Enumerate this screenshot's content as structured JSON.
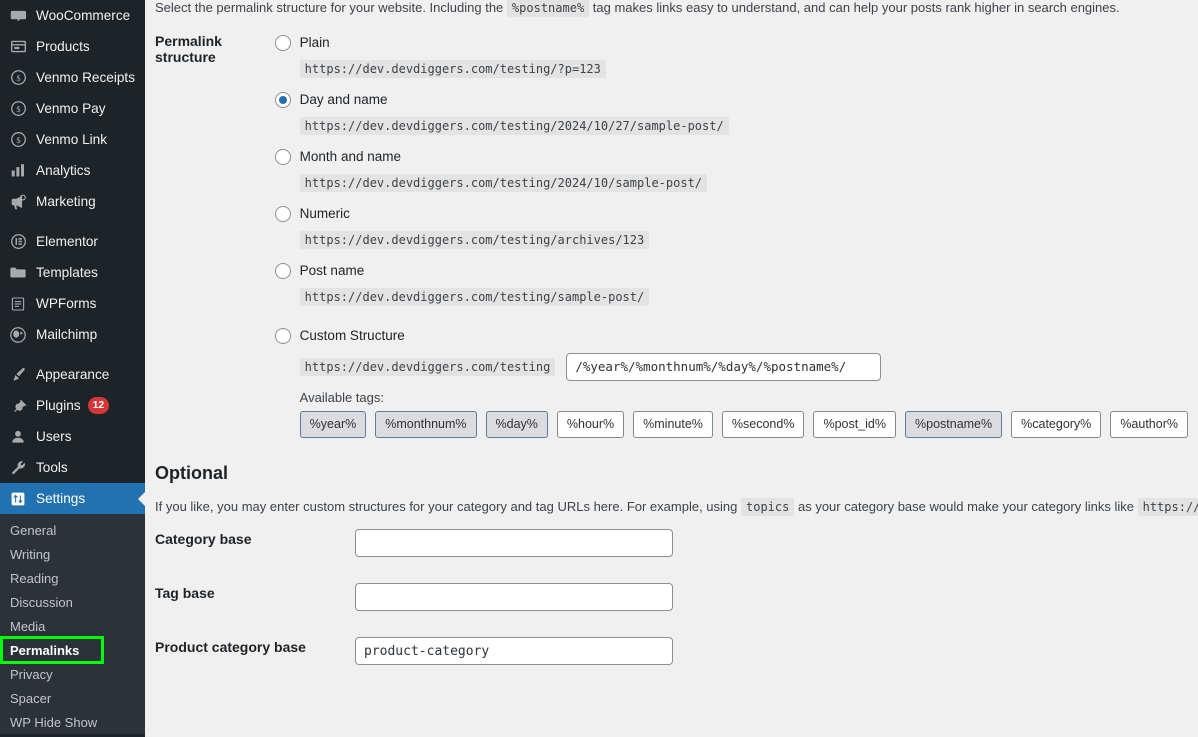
{
  "sidebar": {
    "items": [
      {
        "label": "WooCommerce",
        "icon": "woocommerce-icon"
      },
      {
        "label": "Products",
        "icon": "products-icon"
      },
      {
        "label": "Venmo Receipts",
        "icon": "dollar-icon"
      },
      {
        "label": "Venmo Pay",
        "icon": "dollar-icon"
      },
      {
        "label": "Venmo Link",
        "icon": "dollar-icon"
      },
      {
        "label": "Analytics",
        "icon": "chart-bar-icon"
      },
      {
        "label": "Marketing",
        "icon": "megaphone-icon"
      },
      {
        "label": "Elementor",
        "icon": "elementor-icon"
      },
      {
        "label": "Templates",
        "icon": "folder-icon"
      },
      {
        "label": "WPForms",
        "icon": "form-icon"
      },
      {
        "label": "Mailchimp",
        "icon": "mailchimp-icon"
      },
      {
        "label": "Appearance",
        "icon": "paintbrush-icon"
      },
      {
        "label": "Plugins",
        "icon": "plug-icon",
        "badge": "12"
      },
      {
        "label": "Users",
        "icon": "user-icon"
      },
      {
        "label": "Tools",
        "icon": "wrench-icon"
      },
      {
        "label": "Settings",
        "icon": "settings-icon",
        "active": true
      }
    ],
    "submenu": [
      {
        "label": "General"
      },
      {
        "label": "Writing"
      },
      {
        "label": "Reading"
      },
      {
        "label": "Discussion"
      },
      {
        "label": "Media"
      },
      {
        "label": "Permalinks",
        "current": true,
        "highlighted": true
      },
      {
        "label": "Privacy"
      },
      {
        "label": "Spacer"
      },
      {
        "label": "WP Hide Show"
      }
    ],
    "highlight_color": "#00ff00"
  },
  "intro": {
    "before": "Select the permalink structure for your website. Including the",
    "code": "%postname%",
    "after": "tag makes links easy to understand, and can help your posts rank higher in search engines."
  },
  "permalink": {
    "label": "Permalink structure",
    "options": [
      {
        "label": "Plain",
        "url": "https://dev.devdiggers.com/testing/?p=123",
        "selected": false
      },
      {
        "label": "Day and name",
        "url": "https://dev.devdiggers.com/testing/2024/10/27/sample-post/",
        "selected": true
      },
      {
        "label": "Month and name",
        "url": "https://dev.devdiggers.com/testing/2024/10/sample-post/",
        "selected": false
      },
      {
        "label": "Numeric",
        "url": "https://dev.devdiggers.com/testing/archives/123",
        "selected": false
      },
      {
        "label": "Post name",
        "url": "https://dev.devdiggers.com/testing/sample-post/",
        "selected": false
      }
    ],
    "custom": {
      "label": "Custom Structure",
      "selected": false,
      "prefix": "https://dev.devdiggers.com/testing",
      "value": "/%year%/%monthnum%/%day%/%postname%/"
    },
    "available_tags_label": "Available tags:",
    "tags": [
      {
        "label": "%year%",
        "active": true
      },
      {
        "label": "%monthnum%",
        "active": true
      },
      {
        "label": "%day%",
        "active": true
      },
      {
        "label": "%hour%",
        "active": false
      },
      {
        "label": "%minute%",
        "active": false
      },
      {
        "label": "%second%",
        "active": false
      },
      {
        "label": "%post_id%",
        "active": false
      },
      {
        "label": "%postname%",
        "active": true
      },
      {
        "label": "%category%",
        "active": false
      },
      {
        "label": "%author%",
        "active": false
      }
    ]
  },
  "optional": {
    "title": "Optional",
    "desc_1": "If you like, you may enter custom structures for your category and tag URLs here. For example, using",
    "desc_code_1": "topics",
    "desc_2": "as your category base would make your category links like",
    "desc_code_2": "https://dev.devdiggers.",
    "fields": [
      {
        "label": "Category base",
        "value": "",
        "placeholder": ""
      },
      {
        "label": "Tag base",
        "value": "",
        "placeholder": ""
      },
      {
        "label": "Product category base",
        "value": "product-category",
        "placeholder": ""
      }
    ]
  }
}
